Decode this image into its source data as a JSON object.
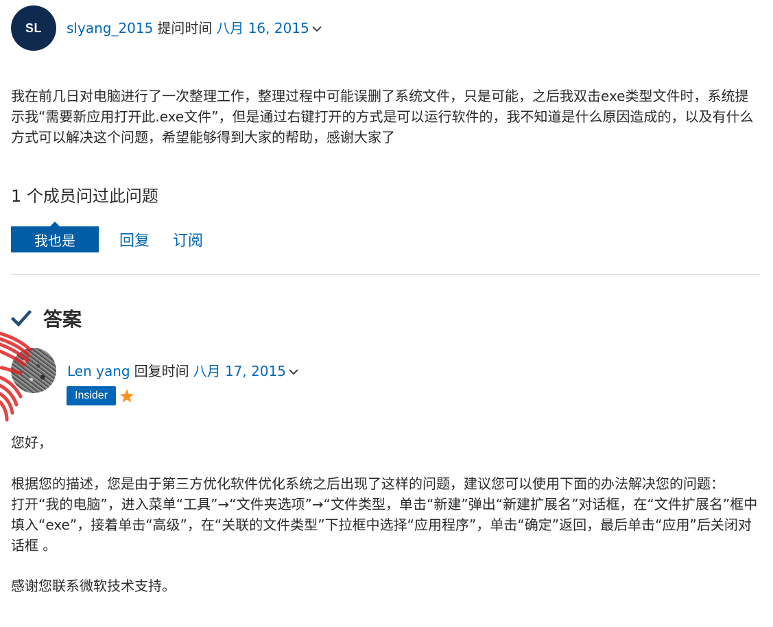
{
  "question": {
    "author_initials": "SL",
    "author_name": "slyang_2015",
    "asked_label": "提问时间",
    "asked_date": "八月 16, 2015",
    "body": "我在前几日对电脑进行了一次整理工作，整理过程中可能误删了系统文件，只是可能，之后我双击exe类型文件时，系统提示我“需要新应用打开此.exe文件”，但是通过右键打开的方式是可以运行软件的，我不知道是什么原因造成的，以及有什么方式可以解决这个问题，希望能够得到大家的帮助，感谢大家了",
    "askers_text": "1 个成员问过此问题"
  },
  "actions": {
    "me_too": "我也是",
    "reply": "回复",
    "subscribe": "订阅"
  },
  "answer": {
    "heading": "答案",
    "author_name": "Len yang",
    "replied_label": "回复时间",
    "replied_date": "八月 17, 2015",
    "badge": "Insider",
    "greeting": "您好，",
    "paragraph1": "根据您的描述，您是由于第三方优化软件优化系统之后出现了这样的问题，建议您可以使用下面的办法解决您的问题：",
    "paragraph2": "打开“我的电脑”，进入菜单“工具”→“文件夹选项”→“文件类型，单击“新建”弹出“新建扩展名”对话框，在“文件扩展名”框中填入“exe”，接着单击“高级”，在“关联的文件类型”下拉框中选择“应用程序”，单击“确定”返回，最后单击“应用”后关闭对话框 。",
    "closing": "感谢您联系微软技术支持。"
  },
  "colors": {
    "link": "#0067b8",
    "button": "#005da6",
    "avatar_sl": "#0f2a4f",
    "check": "#1f4e79",
    "star": "#f7931e"
  }
}
